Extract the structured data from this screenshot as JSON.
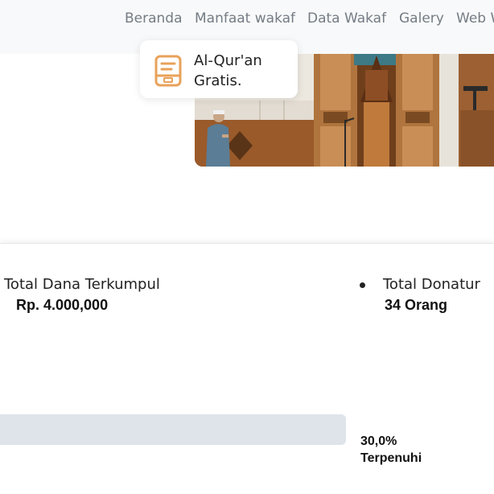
{
  "navbar": {
    "items": [
      "Beranda",
      "Manfaat wakaf",
      "Data Wakaf",
      "Galery",
      "Web W"
    ]
  },
  "feature_card": {
    "icon": "quran-book-icon",
    "line1": "Al-Qur'an",
    "line2": "Gratis."
  },
  "stats": {
    "funds_label": "Total Dana Terkumpul",
    "funds_value": "Rp. 4.000,000",
    "donors_label": "Total Donatur",
    "donors_value": "34 Orang",
    "progress_percent_label": "30,0%",
    "progress_status": "Terpenuhi",
    "progress_fraction": 0.3
  },
  "colors": {
    "nav_text": "#747c84",
    "icon_accent": "#e8a25a",
    "progress_track": "#dee4ea"
  }
}
